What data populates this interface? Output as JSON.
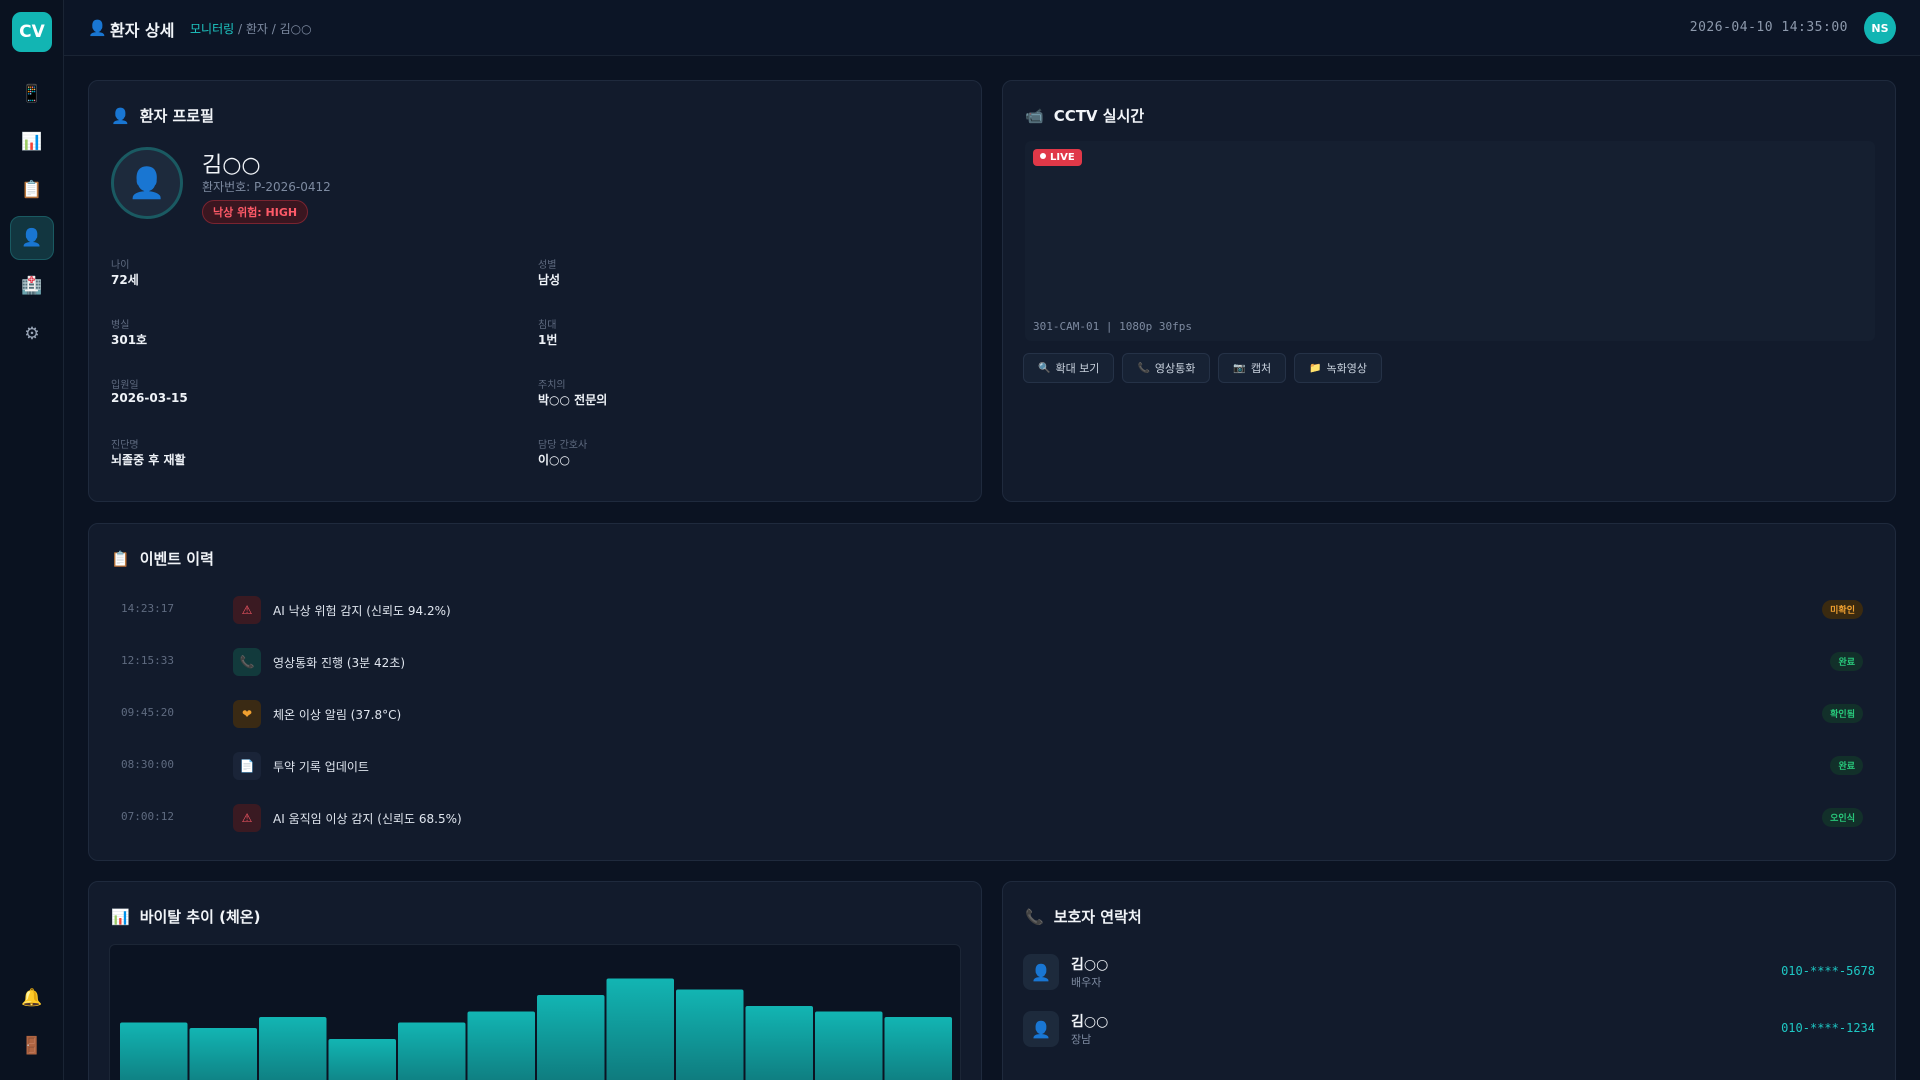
{
  "app": {
    "logo": "CV"
  },
  "sidebar": {
    "items": [
      {
        "icon": "📱",
        "name": "device-icon"
      },
      {
        "icon": "📊",
        "name": "chart-icon"
      },
      {
        "icon": "📋",
        "name": "clipboard-icon"
      },
      {
        "icon": "👤",
        "name": "patient-icon",
        "active": true
      },
      {
        "icon": "🏥",
        "name": "hospital-icon"
      },
      {
        "icon": "⚙",
        "name": "gear-icon"
      }
    ],
    "bottom": [
      {
        "icon": "🔔",
        "name": "bell-icon"
      },
      {
        "icon": "🚪",
        "name": "logout-icon"
      }
    ]
  },
  "header": {
    "icon": "👤",
    "title": "환자 상세",
    "breadcrumb_link": "모니터링",
    "breadcrumb_rest": " / 환자 / 김○○",
    "datetime": "2026-04-10 14:35:00",
    "user_initials": "NS"
  },
  "profile": {
    "title": "환자 프로필",
    "icon": "👤",
    "name": "김○○",
    "patient_id": "환자번호: P-2026-0412",
    "risk": "낙상 위험: HIGH",
    "fields": [
      {
        "label": "나이",
        "value": "72세"
      },
      {
        "label": "성별",
        "value": "남성"
      },
      {
        "label": "병실",
        "value": "301호"
      },
      {
        "label": "침대",
        "value": "1번"
      },
      {
        "label": "입원일",
        "value": "2026-03-15"
      },
      {
        "label": "주치의",
        "value": "박○○ 전문의"
      },
      {
        "label": "진단명",
        "value": "뇌졸중 후 재활"
      },
      {
        "label": "담당 간호사",
        "value": "이○○"
      }
    ]
  },
  "cctv": {
    "title": "CCTV 실시간",
    "icon": "📹",
    "live": "LIVE",
    "cam_info": "301-CAM-01 | 1080p 30fps",
    "buttons": [
      {
        "icon": "🔍",
        "label": "확대 보기",
        "name": "zoom-button"
      },
      {
        "icon": "📞",
        "label": "영상통화",
        "name": "video-call-button"
      },
      {
        "icon": "📷",
        "label": "캡처",
        "name": "capture-button"
      },
      {
        "icon": "📁",
        "label": "녹화영상",
        "name": "recordings-button"
      }
    ]
  },
  "events": {
    "title": "이벤트 이력",
    "icon": "📋",
    "items": [
      {
        "time": "14:23:17",
        "icon": "⚠",
        "text": "AI 낙상 위험 감지 (신뢰도 94.2%)",
        "status": "미확인",
        "kind": "danger",
        "status_kind": "warn"
      },
      {
        "time": "12:15:33",
        "icon": "📞",
        "text": "영상통화 진행 (3분 42초)",
        "status": "완료",
        "kind": "call",
        "status_kind": "ok"
      },
      {
        "time": "09:45:20",
        "icon": "❤",
        "text": "체온 이상 알림 (37.8°C)",
        "status": "확인됨",
        "kind": "vital",
        "status_kind": "ok"
      },
      {
        "time": "08:30:00",
        "icon": "📄",
        "text": "투약 기록 업데이트",
        "status": "완료",
        "kind": "doc",
        "status_kind": "ok"
      },
      {
        "time": "07:00:12",
        "icon": "⚠",
        "text": "AI 움직임 이상 감지 (신뢰도 68.5%)",
        "status": "오인식",
        "kind": "danger",
        "status_kind": "ok"
      }
    ]
  },
  "vitals": {
    "title": "바이탈 추이 (체온)",
    "icon": "📊"
  },
  "chart_data": {
    "type": "bar",
    "title": "바이탈 추이 (체온)",
    "values": [
      36.6,
      36.5,
      36.7,
      36.3,
      36.6,
      36.8,
      37.1,
      37.4,
      37.2,
      36.9,
      36.8,
      36.7
    ],
    "ylim": [
      35.5,
      37.5
    ],
    "color": "#12b5b3"
  },
  "guardians": {
    "title": "보호자 연락처",
    "icon": "📞",
    "items": [
      {
        "name": "김○○",
        "relation": "배우자",
        "phone": "010-****-5678"
      },
      {
        "name": "김○○",
        "relation": "장남",
        "phone": "010-****-1234"
      }
    ]
  },
  "colors": {
    "accent": "#12b5b3",
    "danger": "#ff5a68",
    "warn": "#f0a030",
    "ok": "#28c77a"
  }
}
